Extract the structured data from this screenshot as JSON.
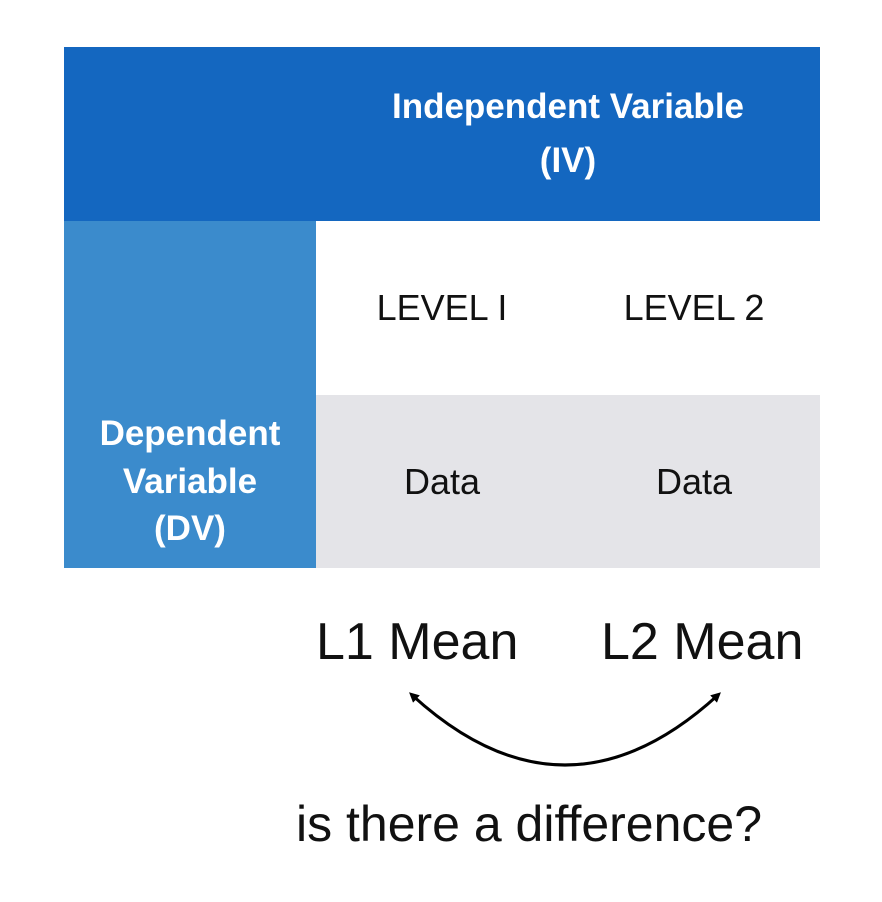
{
  "table": {
    "iv_header": "Independent Variable\n(IV)",
    "dv_header": "Dependent\nVariable\n(DV)",
    "levels": [
      "LEVEL I",
      "LEVEL 2"
    ],
    "data": [
      "Data",
      "Data"
    ]
  },
  "means": {
    "level1": "L1 Mean",
    "level2": "L2 Mean"
  },
  "question": "is there a difference?",
  "colors": {
    "iv_header_bg": "#1467c0",
    "dv_header_bg": "#3b8bcc",
    "data_row_bg": "#e4e4e8"
  }
}
